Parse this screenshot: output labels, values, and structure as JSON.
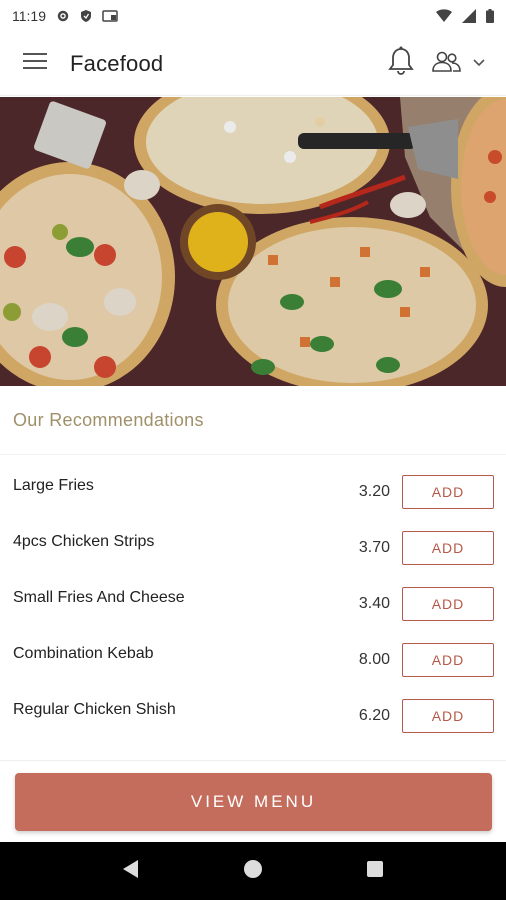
{
  "status_bar": {
    "time": "11:19"
  },
  "app_bar": {
    "title": "Facefood"
  },
  "section": {
    "title": "Our Recommendations"
  },
  "recommendations": [
    {
      "name": "Large Fries",
      "price": "3.20",
      "button": "ADD"
    },
    {
      "name": "4pcs Chicken Strips",
      "price": "3.70",
      "button": "ADD"
    },
    {
      "name": "Small Fries And Cheese",
      "price": "3.40",
      "button": "ADD"
    },
    {
      "name": "Combination Kebab",
      "price": "8.00",
      "button": "ADD"
    },
    {
      "name": "Regular Chicken Shish",
      "price": "6.20",
      "button": "ADD"
    }
  ],
  "cta": {
    "label": "VIEW MENU"
  },
  "colors": {
    "accent": "#c56d5d",
    "accent_border": "#b55a4b",
    "section_title": "#a0906a"
  },
  "icons": {
    "menu": "hamburger-icon",
    "notifications": "bell-icon",
    "account": "users-icon",
    "dropdown": "chevron-down-icon"
  }
}
